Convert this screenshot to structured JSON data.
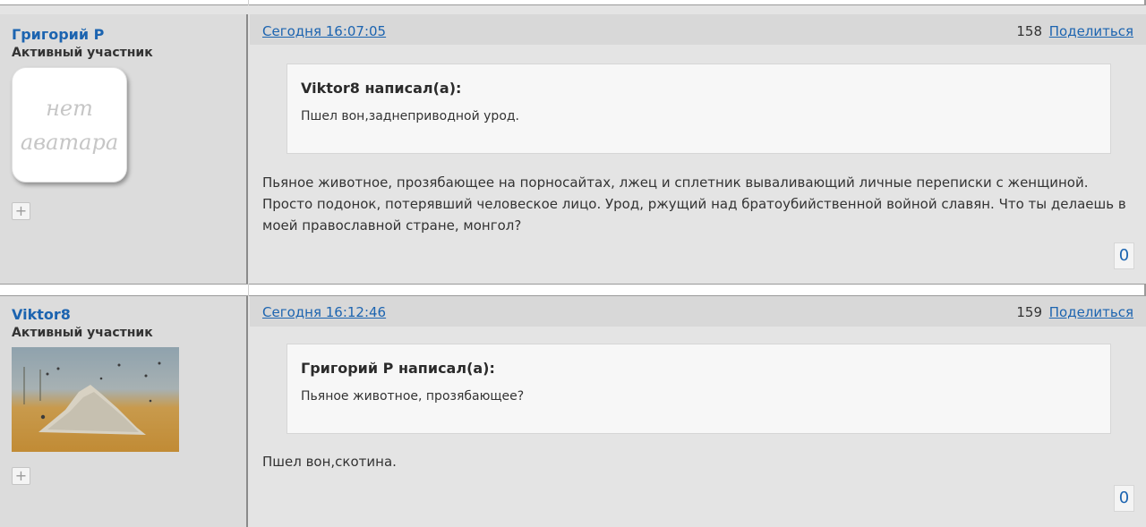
{
  "posts": [
    {
      "author": "Григорий Р",
      "role": "Активный участник",
      "avatar": {
        "type": "none",
        "line1": "нет",
        "line2": "аватара"
      },
      "date": "Сегодня 16:07:05",
      "number": "158",
      "share_label": "Поделиться",
      "quote": {
        "author_line": "Viktor8 написал(а):",
        "text": "Пшел вон,заднеприводной урод."
      },
      "message": "Пьяное животное, прозябающее на порносайтах, лжец и сплетник вываливающий личные переписки с женщиной. Просто подонок, потерявший человеское лицо. Урод, ржущий над братоубийственной войной славян. Что ты делаешь в моей православной стране, монгол?",
      "likes": "0",
      "plus_icon": "plus-icon"
    },
    {
      "author": "Viktor8",
      "role": "Активный участник",
      "avatar": {
        "type": "image",
        "description_icon": "painting-avatar"
      },
      "date": "Сегодня 16:12:46",
      "number": "159",
      "share_label": "Поделиться",
      "quote": {
        "author_line": "Григорий Р написал(а):",
        "text": "Пьяное животное, прозябающее?"
      },
      "message": "Пшел вон,скотина.",
      "likes": "0",
      "plus_icon": "plus-icon"
    }
  ]
}
